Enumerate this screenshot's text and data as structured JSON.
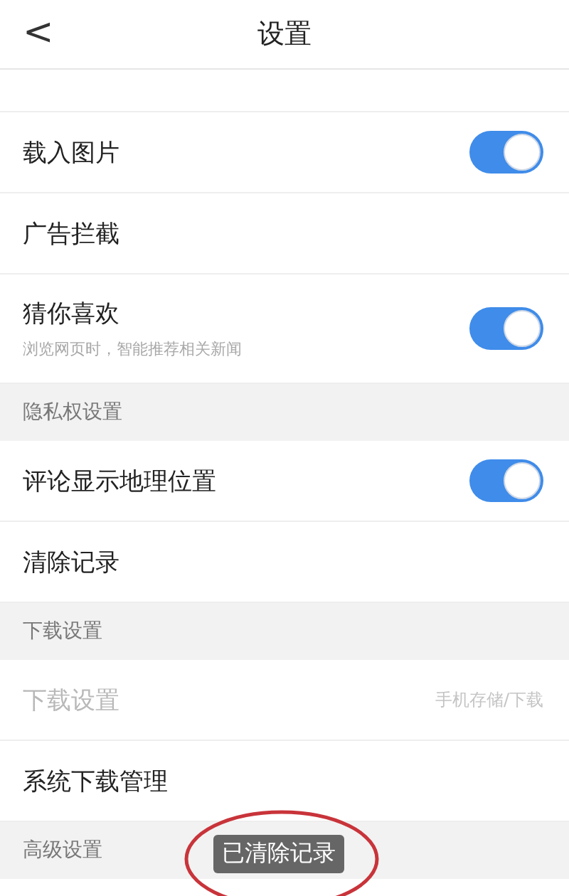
{
  "header": {
    "back": "<",
    "title": "设置"
  },
  "sections": [
    {
      "items": [
        {
          "kind": "blank"
        },
        {
          "kind": "toggle",
          "label": "载入图片",
          "on": true
        },
        {
          "kind": "plain",
          "label": "广告拦截"
        },
        {
          "kind": "toggle",
          "label": "猜你喜欢",
          "subtitle": "浏览网页时，智能推荐相关新闻",
          "on": true
        }
      ]
    },
    {
      "title": "隐私权设置",
      "items": [
        {
          "kind": "toggle",
          "label": "评论显示地理位置",
          "on": true
        },
        {
          "kind": "plain",
          "label": "清除记录"
        }
      ]
    },
    {
      "title": "下载设置",
      "items": [
        {
          "kind": "value",
          "label": "下载设置",
          "value": "手机存储/下载",
          "disabled": true
        },
        {
          "kind": "plain",
          "label": "系统下载管理"
        }
      ]
    },
    {
      "title": "高级设置",
      "items": [
        {
          "kind": "blank"
        }
      ]
    }
  ],
  "toast": {
    "text": "已清除记录",
    "highlighted": true
  }
}
